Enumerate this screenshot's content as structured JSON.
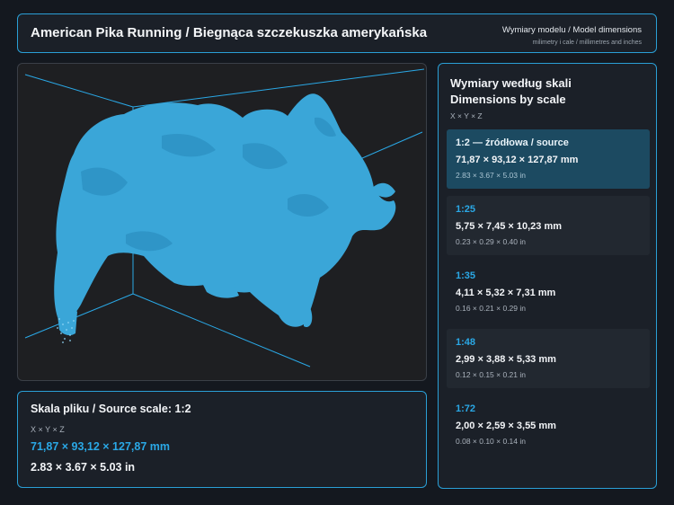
{
  "header": {
    "title": "American Pika Running / Biegnąca szczekuszka amerykańska",
    "dimensions_title": "Wymiary modelu / Model dimensions",
    "dimensions_subtitle": "milimetry i cale / millimetres and inches"
  },
  "viewport": {
    "model_color": "#3aa6d8",
    "line_color": "#2aa8e6"
  },
  "source": {
    "title": "Skala pliku / Source scale: 1:2",
    "axes": "X × Y × Z",
    "mm": "71,87 × 93,12 × 127,87 mm",
    "inches": "2.83 × 3.67 × 5.03 in"
  },
  "scales": {
    "title_line1": "Wymiary według skali",
    "title_line2": "Dimensions by scale",
    "axes": "X × Y × Z",
    "items": [
      {
        "ratio": "1:2  —  źródłowa / source",
        "mm": "71,87 × 93,12 × 127,87 mm",
        "inches": "2.83 × 3.67 × 5.03 in"
      },
      {
        "ratio": "1:25",
        "mm": "5,75 × 7,45 × 10,23 mm",
        "inches": "0.23 × 0.29 × 0.40 in"
      },
      {
        "ratio": "1:35",
        "mm": "4,11 × 5,32 × 7,31 mm",
        "inches": "0.16 × 0.21 × 0.29 in"
      },
      {
        "ratio": "1:48",
        "mm": "2,99 × 3,88 × 5,33 mm",
        "inches": "0.12 × 0.15 × 0.21 in"
      },
      {
        "ratio": "1:72",
        "mm": "2,00 × 2,59 × 3,55 mm",
        "inches": "0.08 × 0.10 × 0.14 in"
      }
    ]
  }
}
